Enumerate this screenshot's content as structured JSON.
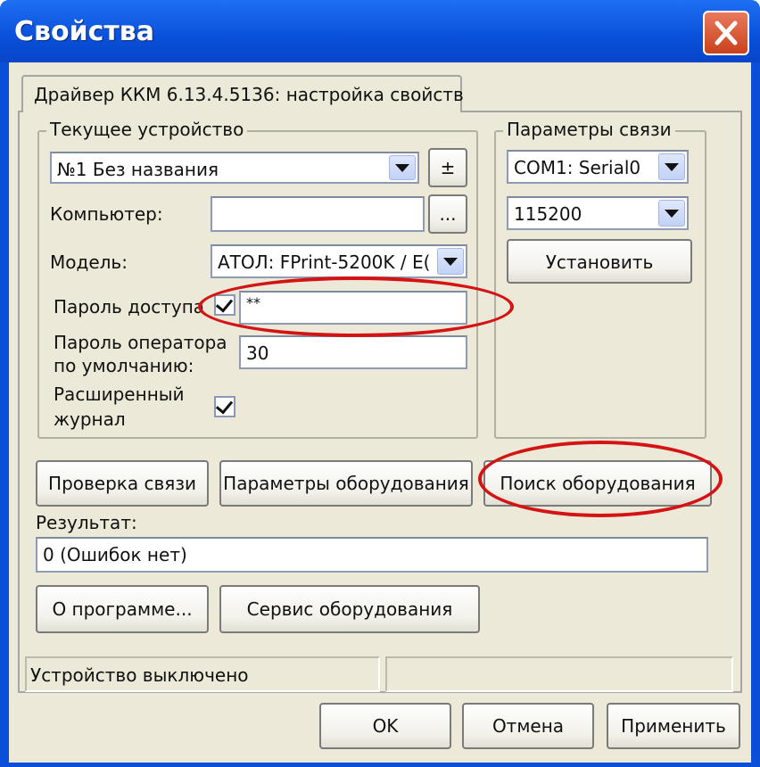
{
  "window": {
    "title": "Свойства",
    "close_icon": "close-icon",
    "colors": {
      "titlebar": "#0a50da",
      "close": "#d9512f",
      "face": "#ece9d8",
      "highlight": "#d41414"
    }
  },
  "tab": {
    "label": "Драйвер ККМ 6.13.4.5136: настройка свойств"
  },
  "current_device": {
    "group_title": "Текущее устройство",
    "device_value": "№1 Без названия",
    "add_remove_label": "±",
    "computer_label": "Компьютер:",
    "computer_value": "",
    "browse_label": "...",
    "model_label": "Модель:",
    "model_value": "АТОЛ: FPrint-5200K / Е(",
    "access_password_label": "Пароль доступа",
    "access_password_checked": true,
    "access_password_value": "**",
    "operator_password_label_1": "Пароль оператора",
    "operator_password_label_2": "по умолчанию:",
    "operator_password_value": "30",
    "extended_journal_label_1": "Расширенный",
    "extended_journal_label_2": "журнал",
    "extended_journal_checked": true
  },
  "connection": {
    "group_title": "Параметры связи",
    "port_value": "COM1: Serial0",
    "baud_value": "115200",
    "set_label": "Установить"
  },
  "actions": {
    "check_connection": "Проверка связи",
    "equipment_params": "Параметры оборудования",
    "equipment_search": "Поиск оборудования"
  },
  "result": {
    "label": "Результат:",
    "value": "0 (Ошибок нет)"
  },
  "more_actions": {
    "about": "О программе...",
    "equipment_service": "Сервис оборудования"
  },
  "status": {
    "text": "Устройство выключено",
    "right_text": ""
  },
  "dialog_buttons": {
    "ok": "OK",
    "cancel": "Отмена",
    "apply": "Применить"
  }
}
